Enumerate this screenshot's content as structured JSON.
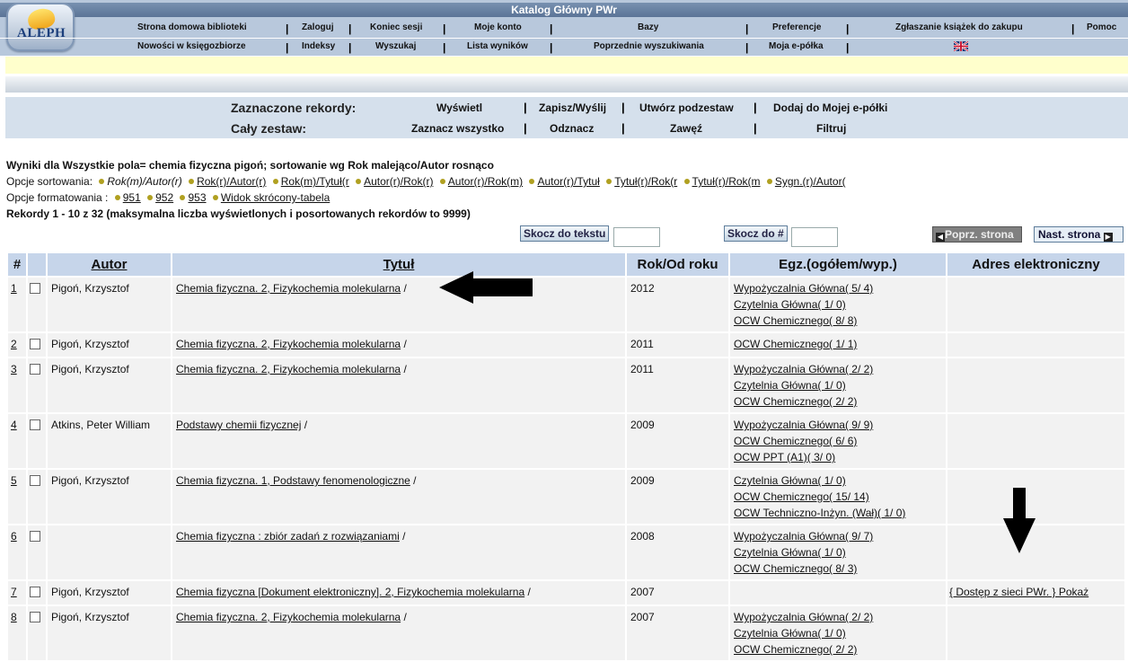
{
  "header": {
    "title": "Katalog Główny PWr",
    "logo_text": "ALEPH",
    "nav_row1": [
      "Strona domowa biblioteki",
      "Zaloguj",
      "Koniec sesji",
      "Moje konto",
      "Bazy",
      "Preferencje",
      "Zgłaszanie książek do zakupu",
      "Pomoc"
    ],
    "nav_row2": [
      "Nowości w księgozbiorze",
      "Indeksy",
      "Wyszukaj",
      "Lista wyników",
      "Poprzednie wyszukiwania",
      "Moja e-półka"
    ]
  },
  "actions": {
    "selected_label": "Zaznaczone rekordy:",
    "selected_items": [
      "Wyświetl",
      "Zapisz/Wyślij",
      "Utwórz podzestaw",
      "Dodaj do Mojej e-półki"
    ],
    "whole_label": "Cały zestaw:",
    "whole_items": [
      "Zaznacz wszystko",
      "Odznacz",
      "Zawęź",
      "Filtruj"
    ]
  },
  "info": {
    "results_for": "Wyniki dla Wszystkie pola= chemia fizyczna pigoń; sortowanie wg Rok malejąco/Autor rosnąco",
    "sort_label": "Opcje sortowania:",
    "sort_current": "Rok(m)/Autor(r)",
    "sort_options": [
      "Rok(r)/Autor(r)",
      "Rok(m)/Tytuł(r",
      "Autor(r)/Rok(r)",
      "Autor(r)/Rok(m)",
      "Autor(r)/Tytuł",
      "Tytuł(r)/Rok(r",
      "Tytuł(r)/Rok(m",
      "Sygn.(r)/Autor("
    ],
    "format_label": "Opcje formatowania :",
    "format_options": [
      "951",
      "952",
      "953",
      "Widok skrócony-tabela"
    ],
    "records_info": "Rekordy 1 - 10 z 32 (maksymalna liczba wyświetlonych i posortowanych rekordów to 9999)"
  },
  "controls": {
    "jump_text": "Skocz do tekstu",
    "jump_num": "Skocz do #",
    "prev_page": "Poprz. strona",
    "next_page": "Nast. strona"
  },
  "table": {
    "headers": [
      "#",
      "",
      "Autor",
      "Tytuł",
      "Rok/Od roku",
      "Egz.(ogółem/wyp.)",
      "Adres elektroniczny"
    ],
    "rows": [
      {
        "num": "1",
        "author": "Pigoń, Krzysztof",
        "title": "Chemia fizyczna. 2, Fizykochemia molekularna",
        "year": "2012",
        "copies": [
          "Wypożyczalnia Główna( 5/ 4)",
          "Czytelnia Główna( 1/ 0)",
          "OCW Chemicznego( 8/ 8)"
        ],
        "eaddr": ""
      },
      {
        "num": "2",
        "author": "Pigoń, Krzysztof",
        "title": "Chemia fizyczna. 2, Fizykochemia molekularna",
        "year": "2011",
        "copies": [
          "OCW Chemicznego( 1/ 1)"
        ],
        "eaddr": ""
      },
      {
        "num": "3",
        "author": "Pigoń, Krzysztof",
        "title": "Chemia fizyczna. 2, Fizykochemia molekularna",
        "year": "2011",
        "copies": [
          "Wypożyczalnia Główna( 2/ 2)",
          "Czytelnia Główna( 1/ 0)",
          "OCW Chemicznego( 2/ 2)"
        ],
        "eaddr": ""
      },
      {
        "num": "4",
        "author": "Atkins, Peter William",
        "title": "Podstawy chemii fizycznej",
        "year": "2009",
        "copies": [
          "Wypożyczalnia Główna( 9/ 9)",
          "OCW Chemicznego( 6/ 6)",
          "OCW PPT (A1)( 3/ 0)"
        ],
        "eaddr": ""
      },
      {
        "num": "5",
        "author": "Pigoń, Krzysztof",
        "title": "Chemia fizyczna. 1, Podstawy fenomenologiczne",
        "year": "2009",
        "copies": [
          "Czytelnia Główna( 1/ 0)",
          "OCW Chemicznego( 15/ 14)",
          "OCW Techniczno-Inżyn. (Wał)( 1/ 0)"
        ],
        "eaddr": ""
      },
      {
        "num": "6",
        "author": "",
        "title": "Chemia fizyczna : zbiór zadań z rozwiązaniami",
        "year": "2008",
        "copies": [
          "Wypożyczalnia Główna( 9/ 7)",
          "Czytelnia Główna( 1/ 0)",
          "OCW Chemicznego( 8/ 3)"
        ],
        "eaddr": ""
      },
      {
        "num": "7",
        "author": "Pigoń, Krzysztof",
        "title": "Chemia fizyczna [Dokument elektroniczny]. 2, Fizykochemia molekularna",
        "year": "2007",
        "copies": [],
        "eaddr": "{ Dostęp z sieci PWr. } Pokaż"
      },
      {
        "num": "8",
        "author": "Pigoń, Krzysztof",
        "title": "Chemia fizyczna. 2, Fizykochemia molekularna",
        "year": "2007",
        "copies": [
          "Wypożyczalnia Główna( 2/ 2)",
          "Czytelnia Główna( 1/ 0)",
          "OCW Chemicznego( 2/ 2)"
        ],
        "eaddr": ""
      }
    ]
  }
}
